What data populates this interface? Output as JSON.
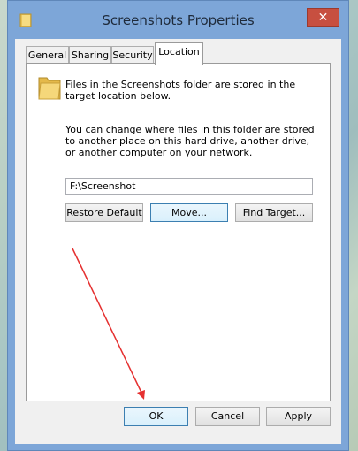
{
  "window": {
    "title": "Screenshots Properties",
    "close_glyph": "✕"
  },
  "tabs": [
    {
      "label": "General",
      "active": false
    },
    {
      "label": "Sharing",
      "active": false
    },
    {
      "label": "Security",
      "active": false
    },
    {
      "label": "Location",
      "active": true
    }
  ],
  "location": {
    "info_text": "Files in the Screenshots folder are stored in the target location below.",
    "change_text": "You can change where files in this folder are stored to another place on this hard drive, another drive, or another computer on your network.",
    "path_value": "F:\\Screenshot",
    "restore_default_label": "Restore Default",
    "move_label": "Move...",
    "find_target_label": "Find Target..."
  },
  "footer": {
    "ok_label": "OK",
    "cancel_label": "Cancel",
    "apply_label": "Apply"
  },
  "colors": {
    "frame": "#7da6d8",
    "close": "#c74f40",
    "arrow": "#e53030",
    "focus_border": "#3c7fb1"
  },
  "icons": {
    "title_icon": "folder-icon",
    "close_icon": "close-icon",
    "location_icon": "folder-icon"
  }
}
